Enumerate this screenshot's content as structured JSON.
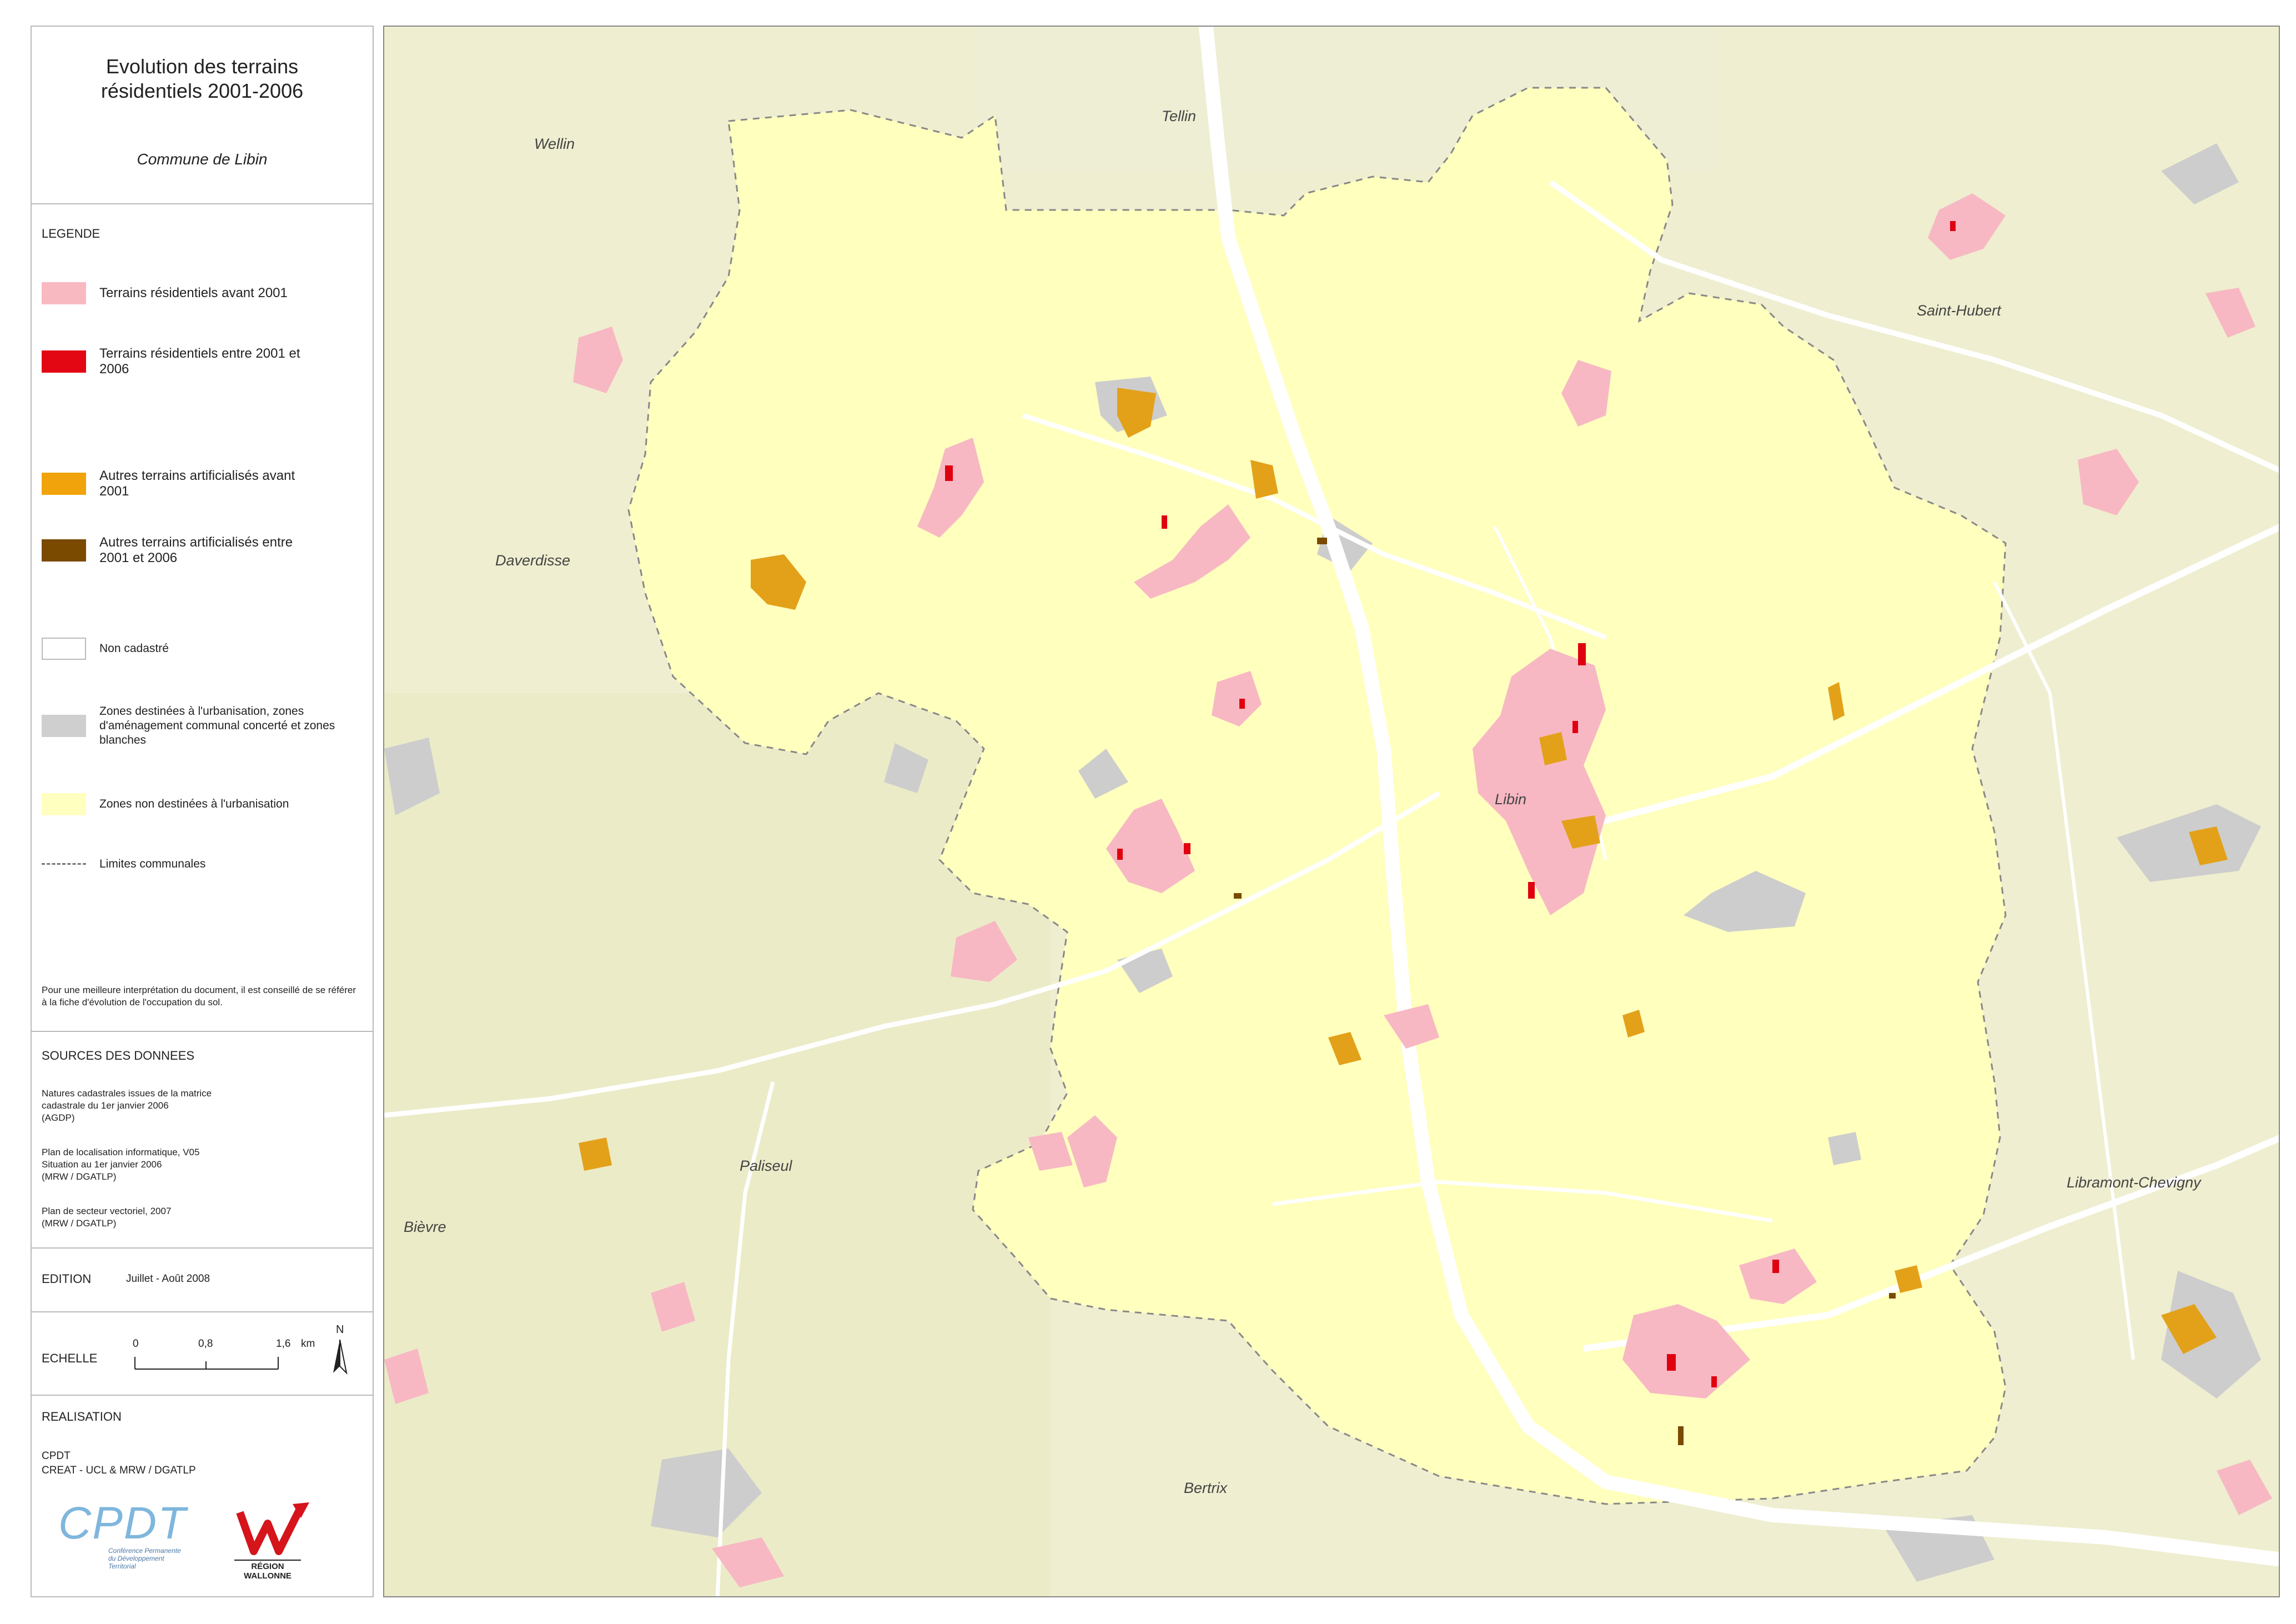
{
  "title": {
    "line1": "Evolution des terrains",
    "line2": "résidentiels 2001-2006",
    "subtitle": "Commune de Libin"
  },
  "legend": {
    "heading": "LEGENDE",
    "items": [
      {
        "label": "Terrains résidentiels avant 2001",
        "color": "#f9b9c0"
      },
      {
        "label": "Terrains résidentiels entre 2001 et 2006",
        "color": "#e30613"
      },
      {
        "label": "Autres terrains artificialisés avant 2001",
        "color": "#f0a30a"
      },
      {
        "label": "Autres terrains artificialisés entre 2001 et 2006",
        "color": "#7a4a00"
      },
      {
        "label": "Non cadastré",
        "color": "#ffffff"
      },
      {
        "label": "Zones destinées à l'urbanisation, zones d'aménagement communal concerté et zones blanches",
        "color": "#cfcfcf"
      },
      {
        "label": "Zones non destinées à l'urbanisation",
        "color": "#ffffc0"
      },
      {
        "label": "Limites communales",
        "color": "#777777"
      }
    ],
    "note": "Pour une meilleure interprétation du document, il est conseillé de se référer à la fiche d'évolution de l'occupation du sol."
  },
  "sources": {
    "heading": "SOURCES DES DONNEES",
    "entries": [
      "Natures cadastrales issues de la matrice\ncadastrale du 1er janvier 2006\n(AGDP)",
      "Plan de localisation informatique, V05\nSituation au 1er janvier 2006\n(MRW / DGATLP)",
      "Plan de secteur vectoriel, 2007\n(MRW / DGATLP)"
    ]
  },
  "edition": {
    "heading": "EDITION",
    "value": "Juillet - Août 2008"
  },
  "scale": {
    "heading": "ECHELLE",
    "ticks": [
      "0",
      "0,8",
      "1,6"
    ],
    "unit": "km",
    "north": "N"
  },
  "realisation": {
    "heading": "REALISATION",
    "line1": "CPDT",
    "line2": "CREAT - UCL & MRW / DGATLP",
    "logo_cpdt": {
      "text": "CPDT",
      "caption1": "Conférence Permanente",
      "caption2": "du Développement",
      "caption3": "Territorial"
    },
    "logo_region": {
      "text": "RÉGION WALLONNE"
    }
  },
  "map": {
    "places": [
      "Wellin",
      "Tellin",
      "Saint-Hubert",
      "Daverdisse",
      "Libin",
      "Paliseul",
      "Bièvre",
      "Libramont-Chevigny",
      "Bertrix"
    ],
    "colors": {
      "outside": "#efeed0",
      "commune": "#ffffbe",
      "residential_old": "#f7b8c3",
      "residential_new": "#e0000f",
      "artificial_old": "#e3a11a",
      "artificial_new": "#7a4a00",
      "urban_zone": "#cfcfcf",
      "road": "#ffffff"
    }
  }
}
